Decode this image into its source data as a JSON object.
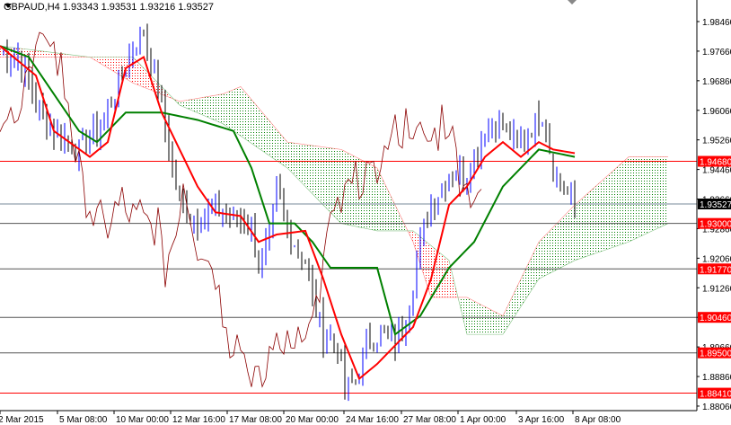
{
  "title": "GBPAUD,H4  1.93343 1.93531 1.93216 1.93527",
  "chart_data": {
    "type": "candlestick",
    "symbol": "GBPAUD",
    "timeframe": "H4",
    "ohlc_last": {
      "open": 1.93343,
      "high": 1.93531,
      "low": 1.93216,
      "close": 1.93527
    },
    "ylim": [
      1.88,
      1.989
    ],
    "y_ticks": [
      "1.98460",
      "1.97660",
      "1.96860",
      "1.96060",
      "1.95260",
      "1.94460",
      "1.93660",
      "1.92860",
      "1.92060",
      "1.91260",
      "1.90460",
      "1.89660",
      "1.88860",
      "1.88060"
    ],
    "x_ticks": [
      "2 Mar 2015",
      "5 Mar 08:00",
      "10 Mar 00:00",
      "12 Mar 16:00",
      "17 Mar 08:00",
      "20 Mar 00:00",
      "24 Mar 16:00",
      "27 Mar 08:00",
      "1 Apr 00:00",
      "3 Apr 16:00",
      "8 Apr 08:00"
    ],
    "levels": [
      {
        "label": "1.94680",
        "value": 1.9468,
        "color": "#ff0000"
      },
      {
        "label": "1.93000",
        "value": 1.93,
        "color": "#ff0000"
      },
      {
        "label": "1.91770",
        "value": 1.9177,
        "color": "#ff0000"
      },
      {
        "label": "1.90460",
        "value": 1.9046,
        "color": "#ff0000"
      },
      {
        "label": "1.89500",
        "value": 1.895,
        "color": "#ff0000"
      },
      {
        "label": "1.88410",
        "value": 1.8841,
        "color": "#ff0000"
      }
    ],
    "current_price": {
      "label": "1.93527",
      "value": 1.93527
    },
    "price_path": [
      [
        0,
        1.976
      ],
      [
        5,
        1.975
      ],
      [
        10,
        1.963
      ],
      [
        15,
        1.955
      ],
      [
        22,
        1.95
      ],
      [
        27,
        1.955
      ],
      [
        32,
        1.965
      ],
      [
        37,
        1.978
      ],
      [
        40,
        1.982
      ],
      [
        44,
        1.967
      ],
      [
        47,
        1.95
      ],
      [
        50,
        1.935
      ],
      [
        55,
        1.931
      ],
      [
        60,
        1.934
      ],
      [
        65,
        1.931
      ],
      [
        70,
        1.93
      ],
      [
        72,
        1.918
      ],
      [
        75,
        1.925
      ],
      [
        77,
        1.94
      ],
      [
        80,
        1.928
      ],
      [
        85,
        1.92
      ],
      [
        87,
        1.91
      ],
      [
        90,
        1.9
      ],
      [
        94,
        1.897
      ],
      [
        96,
        1.885
      ],
      [
        99,
        1.887
      ],
      [
        102,
        1.897
      ],
      [
        106,
        1.9
      ],
      [
        110,
        1.898
      ],
      [
        112,
        1.902
      ],
      [
        115,
        1.913
      ],
      [
        117,
        1.925
      ],
      [
        120,
        1.935
      ],
      [
        125,
        1.943
      ],
      [
        130,
        1.944
      ],
      [
        135,
        1.955
      ],
      [
        140,
        1.957
      ],
      [
        144,
        1.95
      ],
      [
        147,
        1.955
      ],
      [
        151,
        1.96
      ],
      [
        154,
        1.945
      ],
      [
        156,
        1.94
      ],
      [
        160,
        1.9353
      ]
    ],
    "tenkan_sen": [
      [
        0,
        1.978
      ],
      [
        10,
        1.97
      ],
      [
        15,
        1.955
      ],
      [
        25,
        1.948
      ],
      [
        30,
        1.952
      ],
      [
        35,
        1.972
      ],
      [
        40,
        1.975
      ],
      [
        45,
        1.96
      ],
      [
        50,
        1.95
      ],
      [
        55,
        1.94
      ],
      [
        60,
        1.933
      ],
      [
        67,
        1.932
      ],
      [
        72,
        1.925
      ],
      [
        77,
        1.927
      ],
      [
        85,
        1.928
      ],
      [
        90,
        1.915
      ],
      [
        95,
        1.9
      ],
      [
        100,
        1.888
      ],
      [
        105,
        1.892
      ],
      [
        110,
        1.897
      ],
      [
        115,
        1.902
      ],
      [
        120,
        1.915
      ],
      [
        125,
        1.935
      ],
      [
        130,
        1.94
      ],
      [
        135,
        1.948
      ],
      [
        140,
        1.952
      ],
      [
        145,
        1.948
      ],
      [
        150,
        1.952
      ],
      [
        154,
        1.95
      ],
      [
        160,
        1.949
      ]
    ],
    "kijun_sen": [
      [
        0,
        1.978
      ],
      [
        8,
        1.975
      ],
      [
        15,
        1.965
      ],
      [
        22,
        1.955
      ],
      [
        27,
        1.952
      ],
      [
        35,
        1.96
      ],
      [
        45,
        1.96
      ],
      [
        55,
        1.958
      ],
      [
        65,
        1.955
      ],
      [
        70,
        1.945
      ],
      [
        75,
        1.93
      ],
      [
        82,
        1.93
      ],
      [
        87,
        1.925
      ],
      [
        92,
        1.918
      ],
      [
        100,
        1.918
      ],
      [
        105,
        1.918
      ],
      [
        110,
        1.9
      ],
      [
        117,
        1.905
      ],
      [
        125,
        1.918
      ],
      [
        132,
        1.925
      ],
      [
        140,
        1.94
      ],
      [
        145,
        1.945
      ],
      [
        150,
        1.95
      ],
      [
        160,
        1.948
      ]
    ],
    "senkou_span_a": [
      [
        0,
        1.975
      ],
      [
        25,
        1.975
      ],
      [
        37,
        1.968
      ],
      [
        50,
        1.963
      ],
      [
        62,
        1.965
      ],
      [
        67,
        1.967
      ],
      [
        80,
        1.952
      ],
      [
        95,
        1.95
      ],
      [
        105,
        1.945
      ],
      [
        115,
        1.925
      ],
      [
        120,
        1.91
      ],
      [
        130,
        1.91
      ],
      [
        140,
        1.905
      ],
      [
        150,
        1.925
      ],
      [
        160,
        1.935
      ],
      [
        175,
        1.948
      ],
      [
        186,
        1.948
      ]
    ],
    "senkou_span_b": [
      [
        0,
        1.978
      ],
      [
        25,
        1.975
      ],
      [
        37,
        1.975
      ],
      [
        50,
        1.962
      ],
      [
        62,
        1.957
      ],
      [
        80,
        1.945
      ],
      [
        95,
        1.93
      ],
      [
        105,
        1.928
      ],
      [
        115,
        1.928
      ],
      [
        125,
        1.92
      ],
      [
        130,
        1.9
      ],
      [
        140,
        1.9
      ],
      [
        150,
        1.915
      ],
      [
        160,
        1.92
      ],
      [
        175,
        1.925
      ],
      [
        186,
        1.93
      ]
    ],
    "chikou_shift": 26
  }
}
